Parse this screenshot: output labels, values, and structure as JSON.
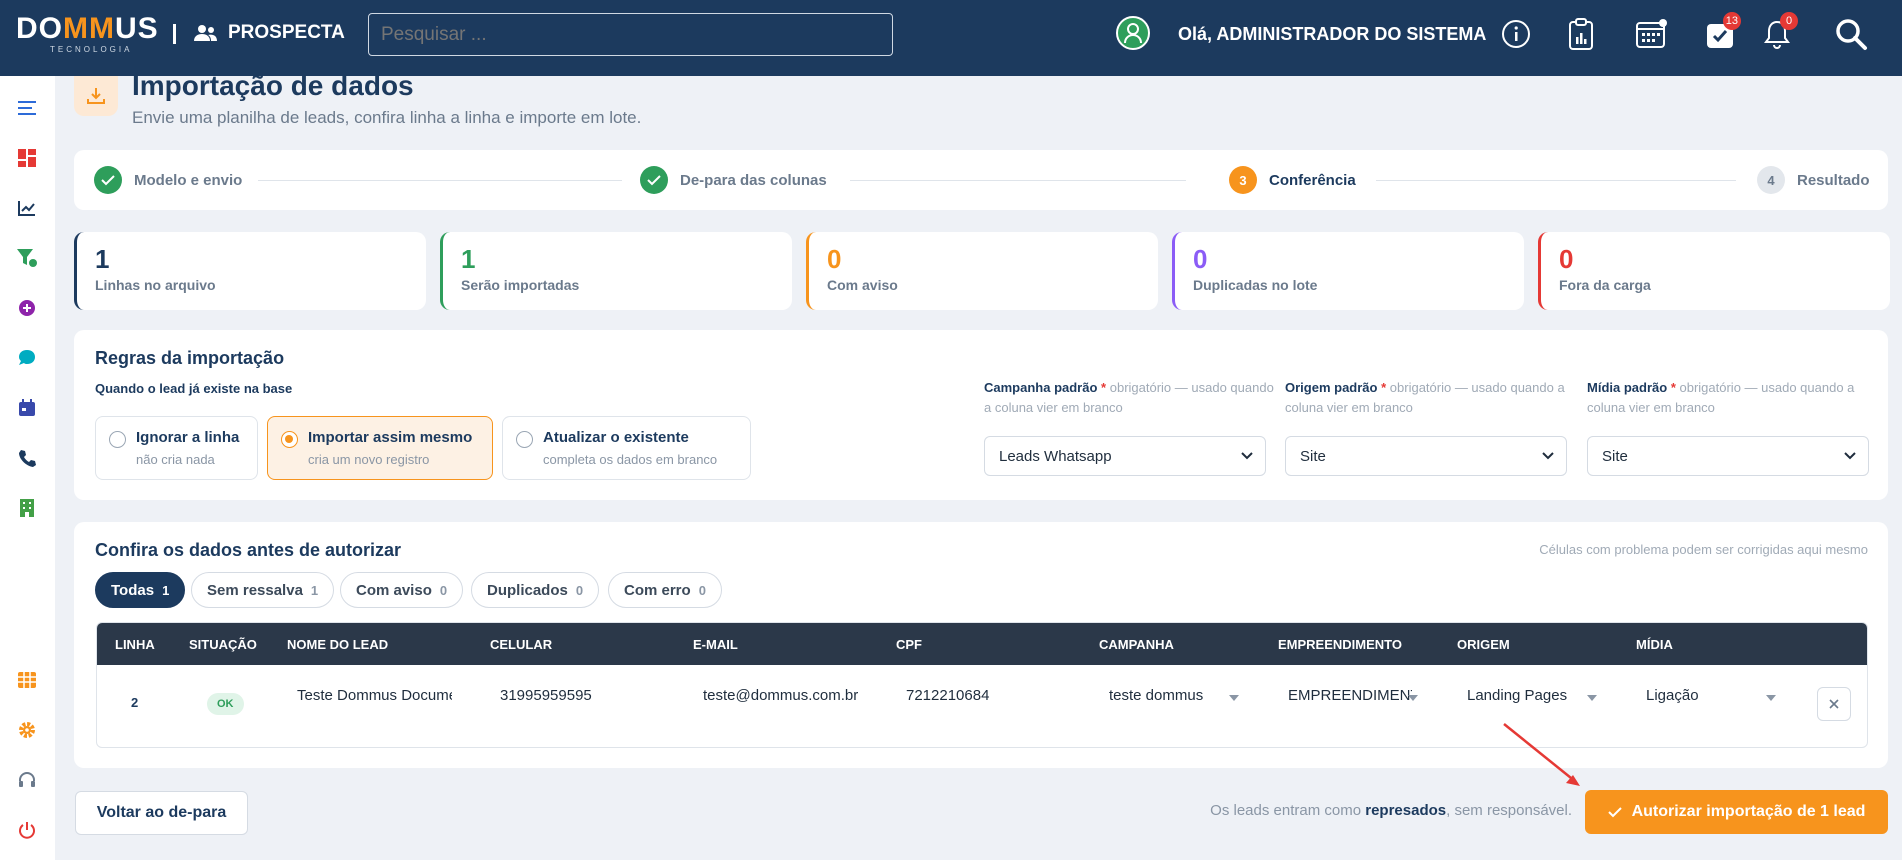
{
  "header": {
    "logo_text_pre": "DO",
    "logo_text_mm": "MM",
    "logo_text_post": "US",
    "logo_sub": "TECNOLOGIA",
    "module": "PROSPECTA",
    "search_placeholder": "Pesquisar ...",
    "greeting": "Olá, ADMINISTRADOR DO SISTEMA",
    "tasks_badge": "13",
    "notifications_badge": "0"
  },
  "page": {
    "title": "Importação de dados",
    "subtitle": "Envie uma planilha de leads, confira linha a linha e importe em lote."
  },
  "steps": [
    {
      "label": "Modelo e envio",
      "state": "done"
    },
    {
      "label": "De-para das colunas",
      "state": "done"
    },
    {
      "num": "3",
      "label": "Conferência",
      "state": "active"
    },
    {
      "num": "4",
      "label": "Resultado",
      "state": "pending"
    }
  ],
  "stats": [
    {
      "value": "1",
      "label": "Linhas no arquivo",
      "color": "#1c3a5e"
    },
    {
      "value": "1",
      "label": "Serão importadas",
      "color": "#2e9e5b"
    },
    {
      "value": "0",
      "label": "Com aviso",
      "color": "#f7941d"
    },
    {
      "value": "0",
      "label": "Duplicadas no lote",
      "color": "#8b5cf6"
    },
    {
      "value": "0",
      "label": "Fora da carga",
      "color": "#e53935"
    }
  ],
  "rules": {
    "title": "Regras da importação",
    "existing_label": "Quando o lead já existe na base",
    "options": [
      {
        "title": "Ignorar a linha",
        "sub": "não cria nada"
      },
      {
        "title": "Importar assim mesmo",
        "sub": "cria um novo registro"
      },
      {
        "title": "Atualizar o existente",
        "sub": "completa os dados em branco"
      }
    ],
    "fields": [
      {
        "label": "Campanha padrão",
        "req": "*",
        "hint": "obrigatório — usado quando a coluna vier em branco",
        "value": "Leads Whatsapp"
      },
      {
        "label": "Origem padrão",
        "req": "*",
        "hint": "obrigatório — usado quando a coluna vier em branco",
        "value": "Site"
      },
      {
        "label": "Mídia padrão",
        "req": "*",
        "hint": "obrigatório — usado quando a coluna vier em branco",
        "value": "Site"
      }
    ]
  },
  "review": {
    "title": "Confira os dados antes de autorizar",
    "hint": "Células com problema podem ser corrigidas aqui mesmo",
    "filters": [
      {
        "label": "Todas",
        "count": "1"
      },
      {
        "label": "Sem ressalva",
        "count": "1"
      },
      {
        "label": "Com aviso",
        "count": "0"
      },
      {
        "label": "Duplicados",
        "count": "0"
      },
      {
        "label": "Com erro",
        "count": "0"
      }
    ],
    "columns": [
      "LINHA",
      "SITUAÇÃO",
      "NOME DO LEAD",
      "CELULAR",
      "E-MAIL",
      "CPF",
      "CAMPANHA",
      "EMPREENDIMENTO",
      "ORIGEM",
      "MÍDIA"
    ],
    "row": {
      "linha": "2",
      "situacao": "OK",
      "nome": "Teste Dommus Documentação",
      "celular": "31995959595",
      "email": "teste@dommus.com.br",
      "cpf": "7212210684",
      "campanha": "teste dommus",
      "empreendimento": "EMPREENDIMENTO",
      "origem": "Landing Pages",
      "midia": "Ligação"
    }
  },
  "footer": {
    "back_label": "Voltar ao de-para",
    "note_pre": "Os leads entram como",
    "note_bold": "represados",
    "note_post": ", sem responsável.",
    "authorize_label": "Autorizar importação de 1 lead"
  }
}
